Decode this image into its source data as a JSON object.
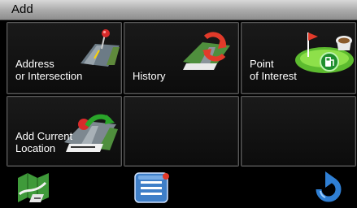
{
  "window": {
    "title": "Add"
  },
  "tiles": [
    {
      "label": "Address\nor Intersection",
      "icon": "map-pin-road-icon"
    },
    {
      "label": "History",
      "icon": "history-refresh-icon"
    },
    {
      "label": "Point\nof Interest",
      "icon": "golf-gas-poi-icon"
    },
    {
      "label": "Add Current\nLocation",
      "icon": "current-location-arrow-icon"
    },
    {
      "label": ""
    },
    {
      "label": ""
    }
  ],
  "bottom": {
    "left_icon": "map-icon",
    "center_icon": "list-menu-icon",
    "right_icon": "back-arrow-icon"
  },
  "colors": {
    "tile_border": "#5b5b5b",
    "title_bar": "#b5b5b5",
    "accent_green": "#3fae2a",
    "accent_red": "#e23a2a",
    "accent_blue": "#2f7fd4"
  }
}
